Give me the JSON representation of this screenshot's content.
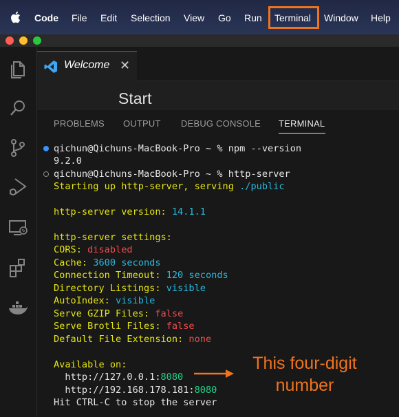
{
  "menubar": {
    "app_name": "Code",
    "items": [
      "File",
      "Edit",
      "Selection",
      "View",
      "Go",
      "Run",
      "Terminal",
      "Window",
      "Help"
    ]
  },
  "tab": {
    "label": "Welcome",
    "close": "✕"
  },
  "editor": {
    "heading": "Start"
  },
  "panel": {
    "tabs": [
      "PROBLEMS",
      "OUTPUT",
      "DEBUG CONSOLE",
      "TERMINAL"
    ],
    "active_tab": "TERMINAL"
  },
  "terminal": {
    "prompt": "qichun@Qichuns-MacBook-Pro ~ % ",
    "cmd1": "npm --version",
    "out1": "9.2.0",
    "cmd2": "http-server",
    "start_a": "Starting up http-server, serving ",
    "start_b": "./public",
    "version_label": "http-server version: ",
    "version_value": "14.1.1",
    "settings_label": "http-server settings:",
    "settings": [
      {
        "label": "CORS: ",
        "value": "disabled",
        "color": "#f14c4c"
      },
      {
        "label": "Cache: ",
        "value": "3600 seconds",
        "color": "#29b8db"
      },
      {
        "label": "Connection Timeout: ",
        "value": "120 seconds",
        "color": "#29b8db"
      },
      {
        "label": "Directory Listings: ",
        "value": "visible",
        "color": "#29b8db"
      },
      {
        "label": "AutoIndex: ",
        "value": "visible",
        "color": "#29b8db"
      },
      {
        "label": "Serve GZIP Files: ",
        "value": "false",
        "color": "#f14c4c"
      },
      {
        "label": "Serve Brotli Files: ",
        "value": "false",
        "color": "#f14c4c"
      },
      {
        "label": "Default File Extension: ",
        "value": "none",
        "color": "#f14c4c"
      }
    ],
    "available_label": "Available on:",
    "url1_host": "  http://127.0.0.1:",
    "url1_port": "8080",
    "url2_host": "  http://192.168.178.181:",
    "url2_port": "8080",
    "stop_hint": "Hit CTRL-C to stop the server"
  },
  "annotation": {
    "line1": "This four-digit",
    "line2": "number",
    "color": "#f0731e"
  },
  "icons": {
    "apple": "apple-icon",
    "activity": [
      "explorer-icon",
      "search-icon",
      "source-control-icon",
      "run-debug-icon",
      "remote-explorer-icon",
      "extensions-icon",
      "docker-icon"
    ]
  }
}
